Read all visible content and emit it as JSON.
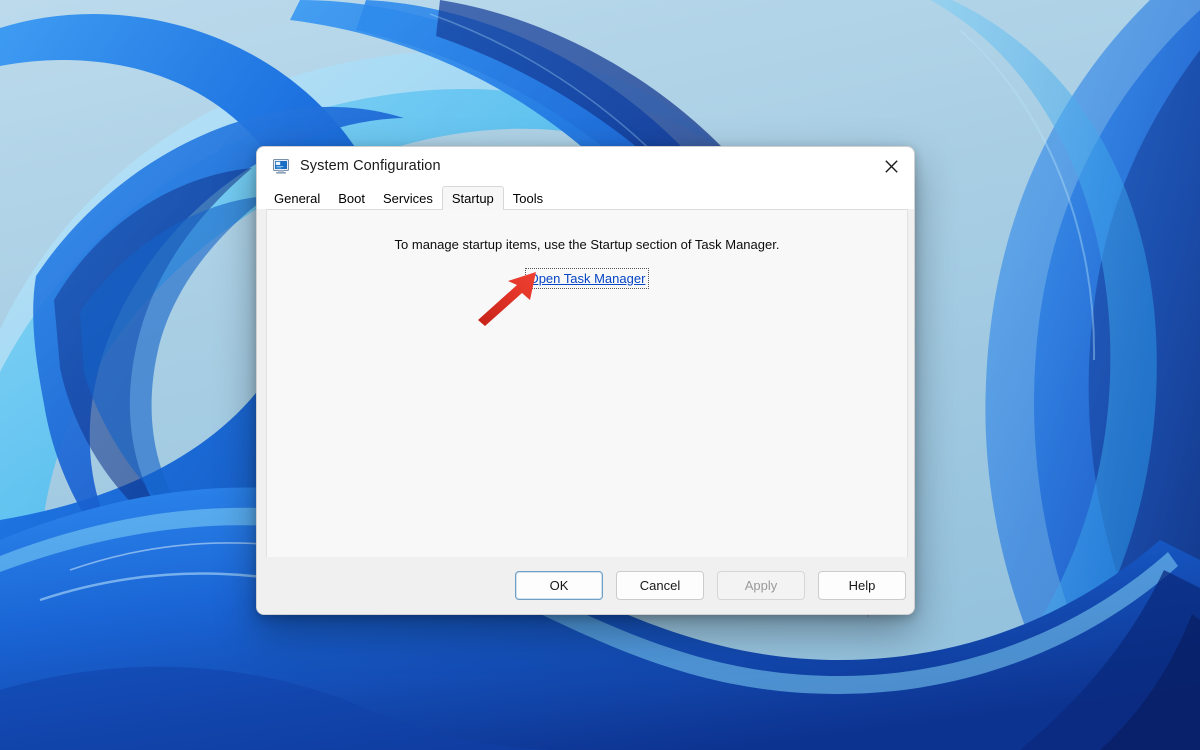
{
  "desktop": {
    "wallpaper_name": "windows-11-bloom-wallpaper",
    "colors": {
      "sky_light": "#b6d6e9",
      "sky_mid": "#a4cbe2",
      "ribbon_bright": "#1f7ced",
      "ribbon_mid": "#2a6fd6",
      "ribbon_deep": "#123a9e",
      "ribbon_dark": "#0c2a7a",
      "ribbon_pale": "#62b8ef",
      "ribbon_cyan": "#4ec3f0"
    }
  },
  "dialog": {
    "title": "System Configuration",
    "icon": "system-configuration-icon",
    "close_label": "Close",
    "close_icon": "close-icon",
    "tabs": [
      {
        "label": "General",
        "active": false
      },
      {
        "label": "Boot",
        "active": false
      },
      {
        "label": "Services",
        "active": false
      },
      {
        "label": "Startup",
        "active": true
      },
      {
        "label": "Tools",
        "active": false
      }
    ],
    "startup_panel": {
      "message": "To manage startup items, use the Startup section of Task Manager.",
      "link_label": "Open Task Manager"
    },
    "buttons": [
      {
        "label": "OK",
        "state": "default"
      },
      {
        "label": "Cancel",
        "state": "normal"
      },
      {
        "label": "Apply",
        "state": "disabled"
      },
      {
        "label": "Help",
        "state": "normal"
      }
    ]
  },
  "annotation": {
    "arrow_color": "#e23426",
    "arrow_name": "red-pointer-arrow",
    "points_to": "Open Task Manager"
  }
}
